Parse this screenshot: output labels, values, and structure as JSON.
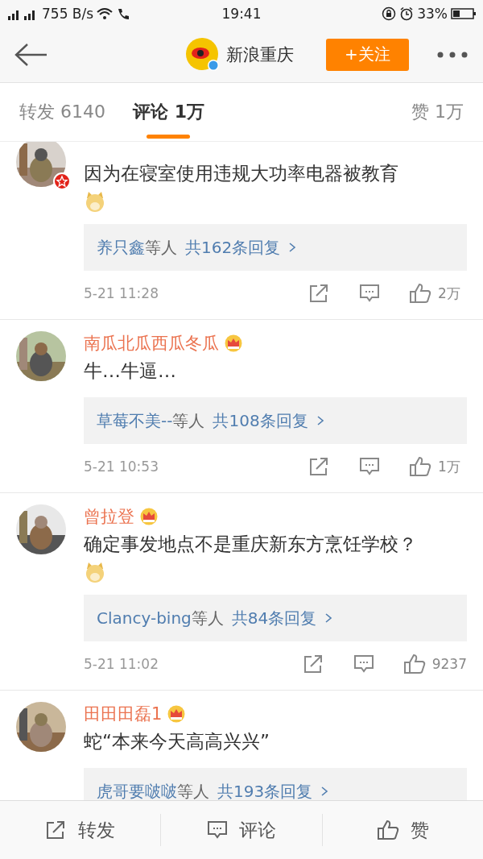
{
  "status_bar": {
    "speed": "755 B/s",
    "time": "19:41",
    "battery": "33%"
  },
  "header": {
    "account": "新浪重庆",
    "follow_button": "+关注"
  },
  "tabs": [
    {
      "label": "转发 6140",
      "selected": false
    },
    {
      "label": "评论 1万",
      "selected": true
    },
    {
      "label": "赞 1万",
      "selected": false
    }
  ],
  "comments": [
    {
      "text": "因为在寝室使用违规大功率电器被教育",
      "emoji": true,
      "badge": true,
      "replies": {
        "users": "养只鑫",
        "suffix": "等人",
        "count": "共162条回复"
      },
      "time": "5-21 11:28",
      "likes": "2万"
    },
    {
      "name": "南瓜北瓜西瓜冬瓜",
      "text": "牛…牛逼…",
      "emoji": false,
      "badge": false,
      "replies": {
        "users": "草莓不美--",
        "suffix": "等人",
        "count": "共108条回复"
      },
      "time": "5-21 10:53",
      "likes": "1万"
    },
    {
      "name": "曾拉登",
      "text": "确定事发地点不是重庆新东方烹饪学校？",
      "emoji": true,
      "badge": false,
      "replies": {
        "users": "Clancy-bing",
        "suffix": "等人",
        "count": "共84条回复"
      },
      "time": "5-21 11:02",
      "likes": "9237"
    },
    {
      "name": "田田田磊1",
      "text": "蛇“本来今天高高兴兴”",
      "emoji": false,
      "badge": false,
      "replies": {
        "users": "虎哥要啵啵",
        "suffix": "等人",
        "count": "共193条回复"
      }
    }
  ],
  "bottom_bar": [
    {
      "label": "转发",
      "kind": "share"
    },
    {
      "label": "评论",
      "kind": "comment"
    },
    {
      "label": "赞",
      "kind": "like"
    }
  ]
}
